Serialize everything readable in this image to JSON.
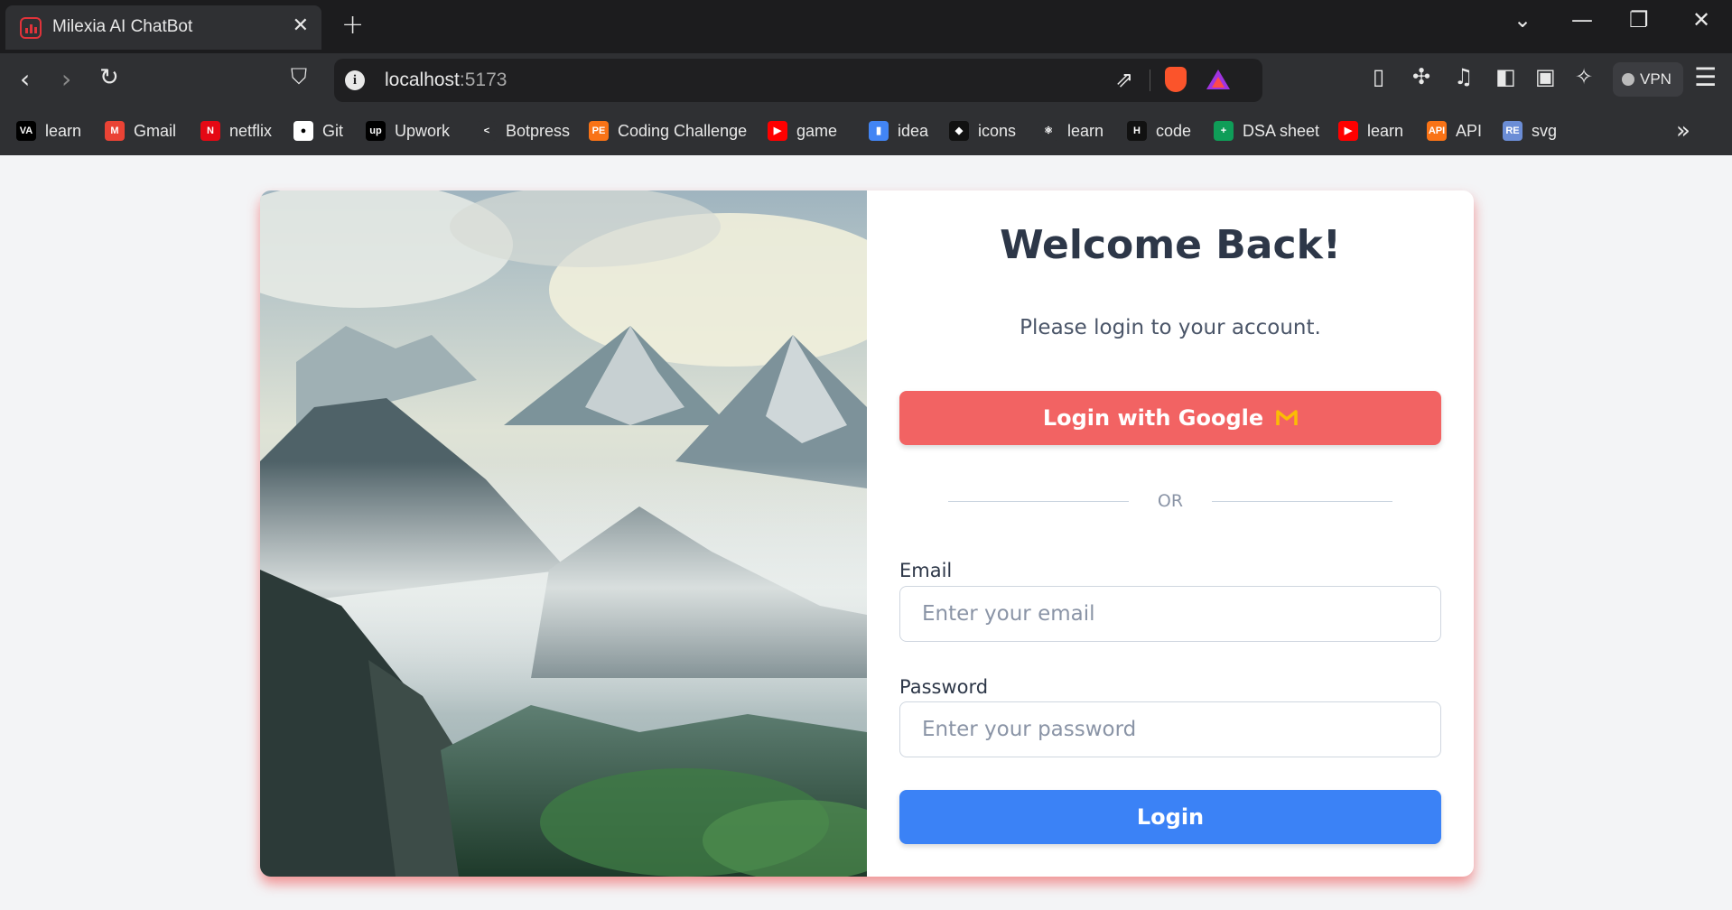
{
  "browser": {
    "tab_title": "Milexia AI ChatBot",
    "tab_close": "✕",
    "new_tab": "+",
    "url_host": "localhost",
    "url_port": ":5173",
    "vpn_label": "VPN",
    "bookmarks_more": "»",
    "bookmarks": [
      {
        "label": "learn",
        "icon": "VA",
        "color": "#000000"
      },
      {
        "label": "Gmail",
        "icon": "M",
        "color": "#ea4335"
      },
      {
        "label": "netflix",
        "icon": "N",
        "color": "#e50914"
      },
      {
        "label": "Git",
        "icon": "●",
        "color": "#ffffff"
      },
      {
        "label": "Upwork",
        "icon": "up",
        "color": "#000000"
      },
      {
        "label": "Botpress",
        "icon": "<",
        "color": "#2f3033"
      },
      {
        "label": "Coding Challenge",
        "icon": "PE",
        "color": "#f97316"
      },
      {
        "label": "game",
        "icon": "▶",
        "color": "#ff0000"
      },
      {
        "label": "idea",
        "icon": "▮",
        "color": "#4285f4"
      },
      {
        "label": "icons",
        "icon": "◆",
        "color": "#111111"
      },
      {
        "label": "learn",
        "icon": "⚛",
        "color": "#2f3033"
      },
      {
        "label": "code",
        "icon": "H",
        "color": "#111111"
      },
      {
        "label": "DSA sheet",
        "icon": "+",
        "color": "#0f9d58"
      },
      {
        "label": "learn",
        "icon": "▶",
        "color": "#ff0000"
      },
      {
        "label": "API",
        "icon": "API",
        "color": "#f97316"
      },
      {
        "label": "svg",
        "icon": "RE",
        "color": "#6b8dd6"
      }
    ]
  },
  "login": {
    "heading": "Welcome Back!",
    "subtitle": "Please login to your account.",
    "google_button": "Login with Google",
    "divider_text": "OR",
    "email_label": "Email",
    "email_placeholder": "Enter your email",
    "password_label": "Password",
    "password_placeholder": "Enter your password",
    "login_button": "Login"
  },
  "colors": {
    "google_button": "#f26363",
    "login_button": "#3b82f6",
    "heading": "#2d3748",
    "page_bg": "#f3f4f6"
  }
}
